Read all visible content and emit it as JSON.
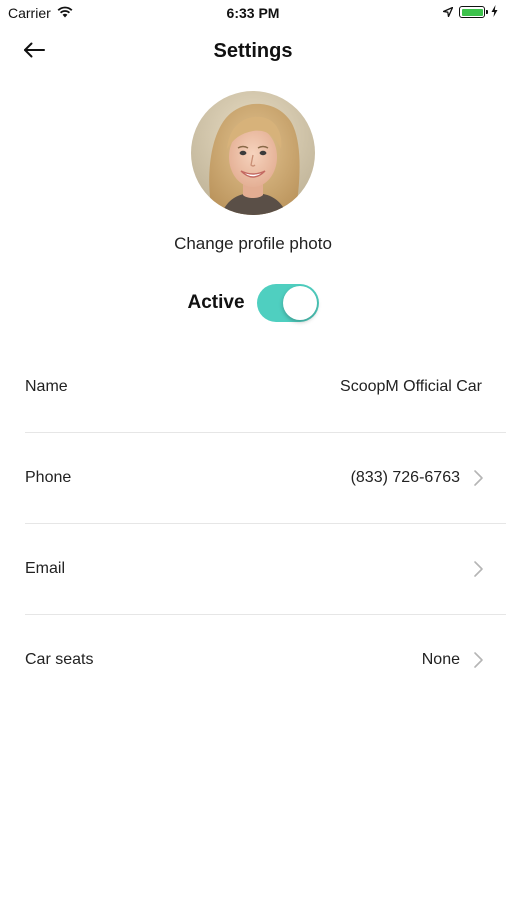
{
  "status_bar": {
    "carrier": "Carrier",
    "time": "6:33 PM",
    "battery_level": 1.0
  },
  "nav": {
    "title": "Settings"
  },
  "profile": {
    "change_photo_label": "Change profile photo",
    "active_label": "Active",
    "active": true
  },
  "rows": [
    {
      "label": "Name",
      "value": "ScoopM Official Car",
      "chevron": false
    },
    {
      "label": "Phone",
      "value": "(833) 726-6763",
      "chevron": true
    },
    {
      "label": "Email",
      "value": "",
      "chevron": true
    },
    {
      "label": "Car seats",
      "value": "None",
      "chevron": true
    }
  ],
  "colors": {
    "accent": "#4fcfc0",
    "battery": "#3dc24c",
    "divider": "#e6e6e6"
  }
}
